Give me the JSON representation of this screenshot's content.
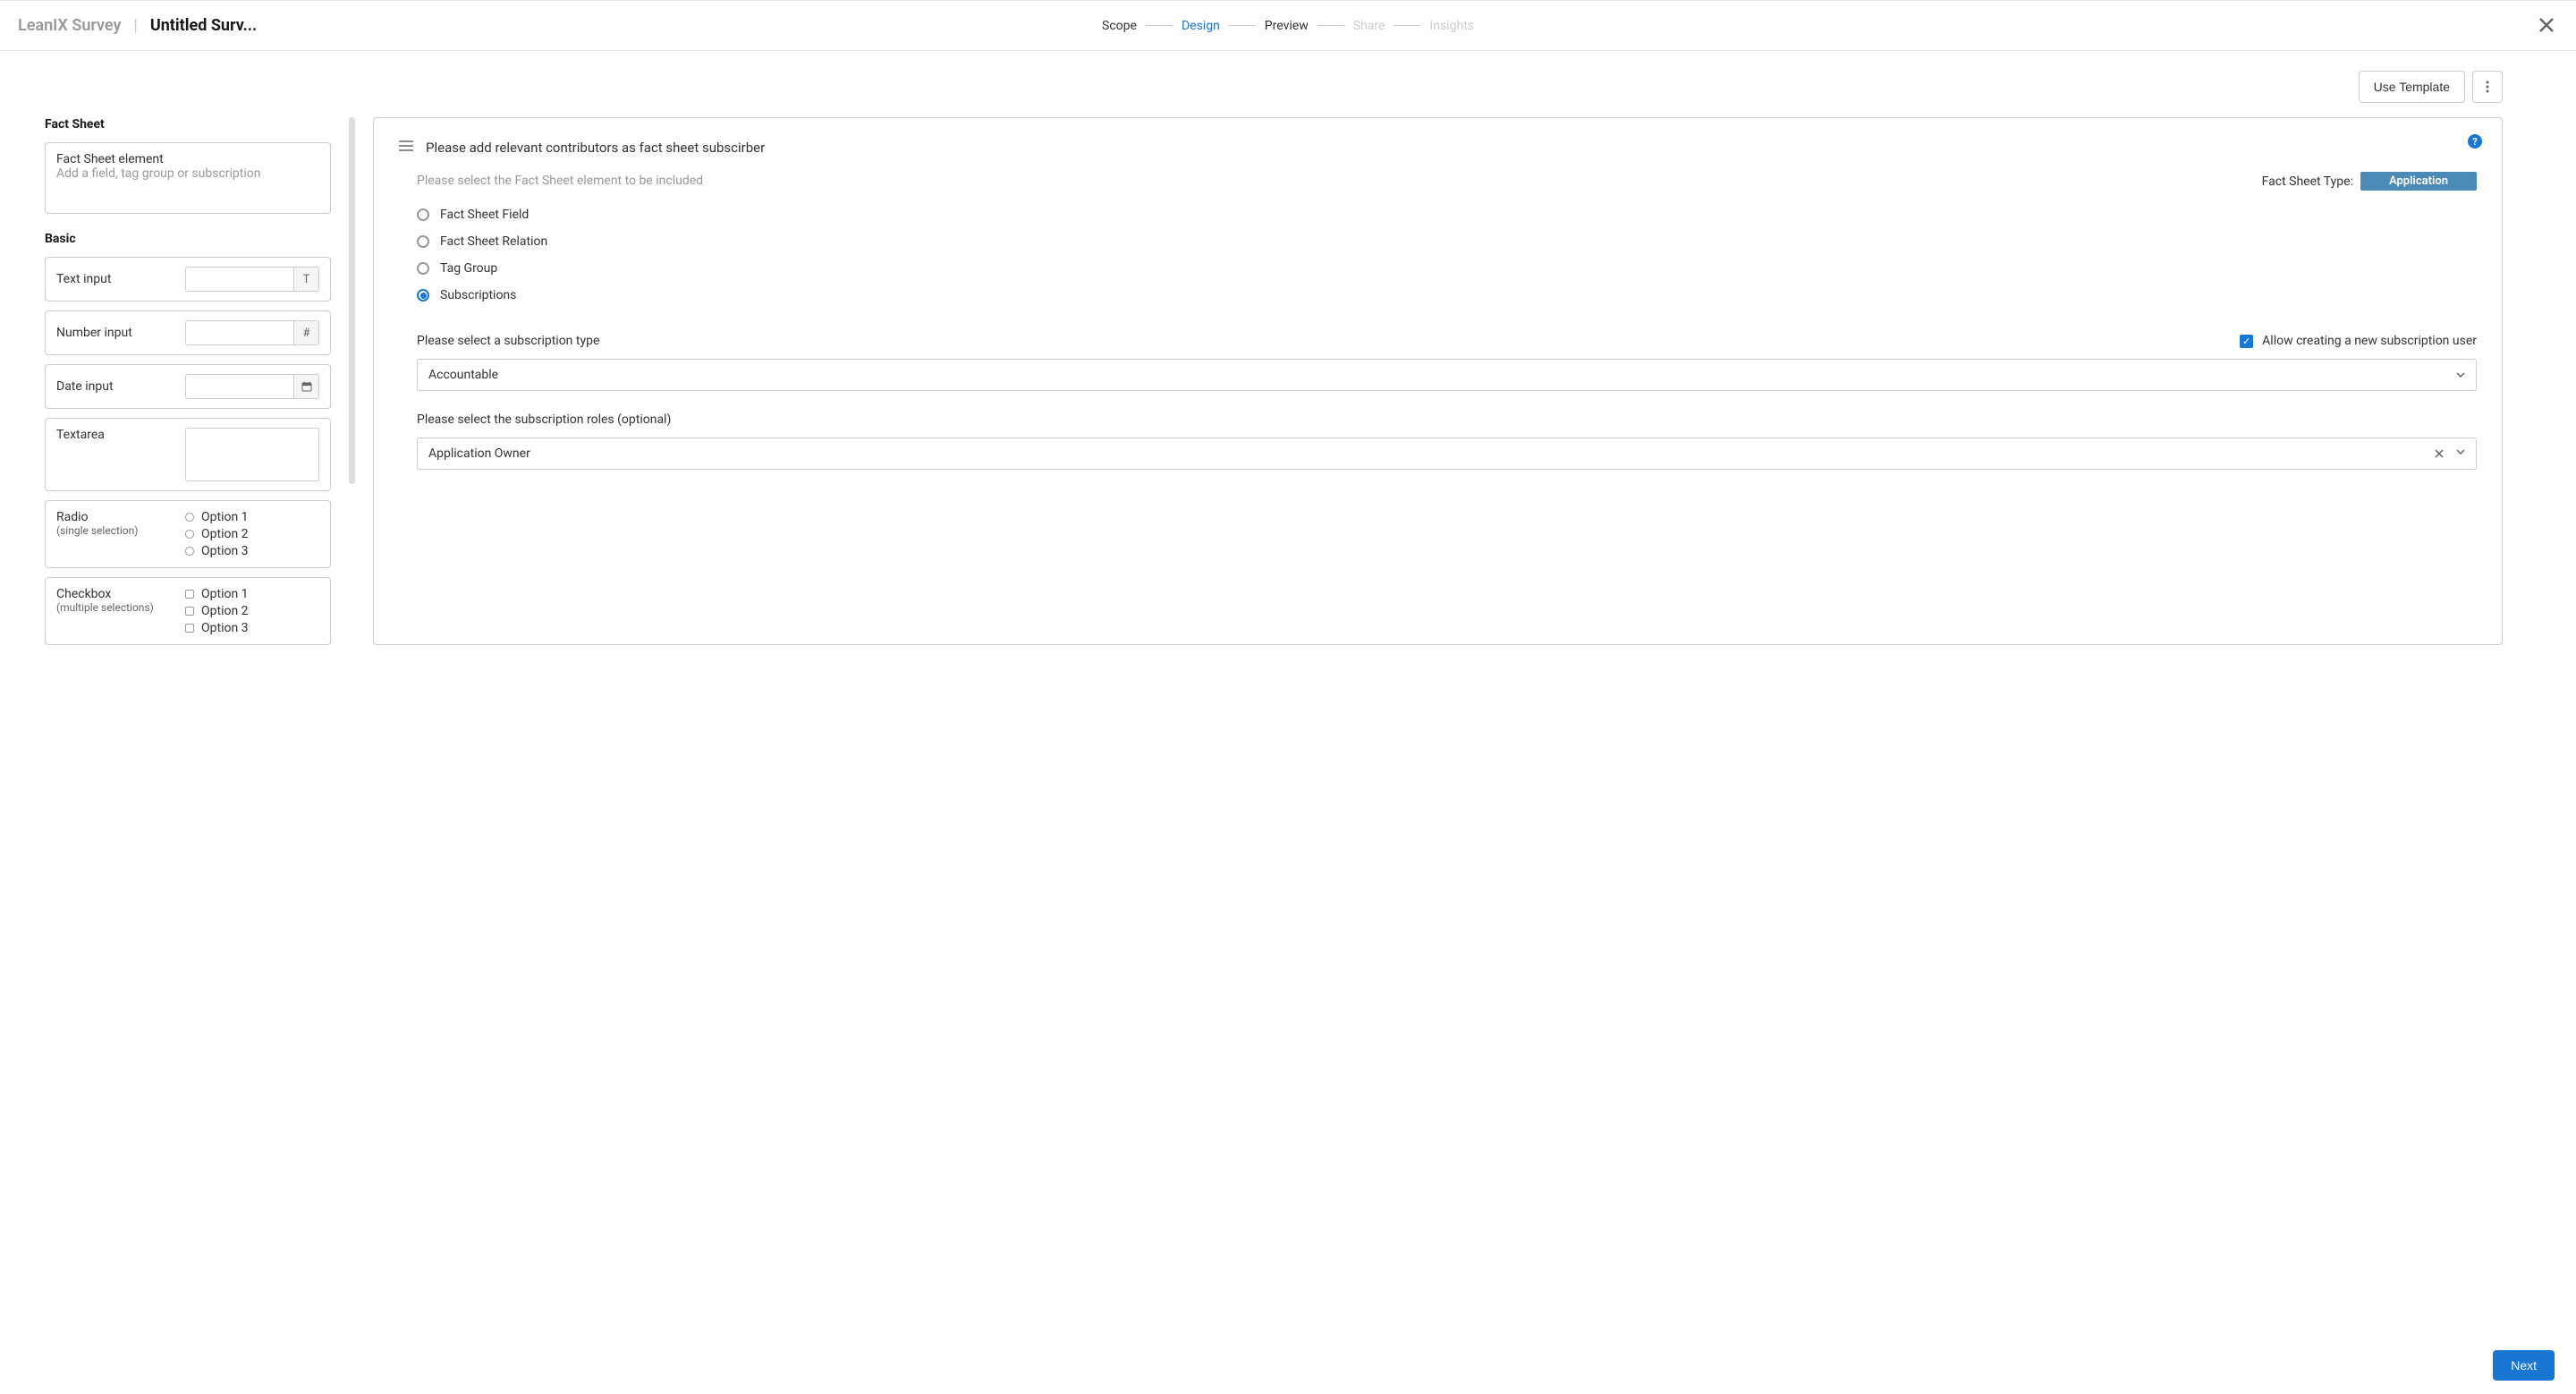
{
  "header": {
    "brand": "LeanIX Survey",
    "divider": "|",
    "surveyTitle": "Untitled Surv..."
  },
  "breadcrumb": {
    "steps": [
      {
        "label": "Scope",
        "state": "normal"
      },
      {
        "label": "Design",
        "state": "active"
      },
      {
        "label": "Preview",
        "state": "normal"
      },
      {
        "label": "Share",
        "state": "disabled"
      },
      {
        "label": "Insights",
        "state": "disabled"
      }
    ]
  },
  "toolbar": {
    "useTemplate": "Use Template"
  },
  "sidebar": {
    "factSheet": {
      "sectionLabel": "Fact Sheet",
      "title": "Fact Sheet element",
      "subtitle": "Add a field, tag group or subscription"
    },
    "basic": {
      "sectionLabel": "Basic",
      "textInput": {
        "label": "Text input",
        "addon": "T"
      },
      "numberInput": {
        "label": "Number input",
        "addon": "#"
      },
      "dateInput": {
        "label": "Date input"
      },
      "textarea": {
        "label": "Textarea"
      },
      "radio": {
        "label": "Radio",
        "sublabel": "(single selection)",
        "options": [
          "Option 1",
          "Option 2",
          "Option 3"
        ]
      },
      "checkbox": {
        "label": "Checkbox",
        "sublabel": "(multiple selections)",
        "options": [
          "Option 1",
          "Option 2",
          "Option 3"
        ]
      }
    }
  },
  "editor": {
    "questionText": "Please add relevant contributors as fact sheet subscirber",
    "elementHint": "Please select the Fact Sheet element to be included",
    "fsTypeLabel": "Fact Sheet Type:",
    "fsTypeBadge": "Application",
    "elementOptions": [
      {
        "label": "Fact Sheet Field",
        "selected": false
      },
      {
        "label": "Fact Sheet Relation",
        "selected": false
      },
      {
        "label": "Tag Group",
        "selected": false
      },
      {
        "label": "Subscriptions",
        "selected": true
      }
    ],
    "subscriptionTypeLabel": "Please select a subscription type",
    "allowNewUser": "Allow creating a new subscription user",
    "subscriptionTypeValue": "Accountable",
    "rolesLabel": "Please select the subscription roles (optional)",
    "rolesValue": "Application Owner"
  },
  "footer": {
    "nextLabel": "Next"
  }
}
